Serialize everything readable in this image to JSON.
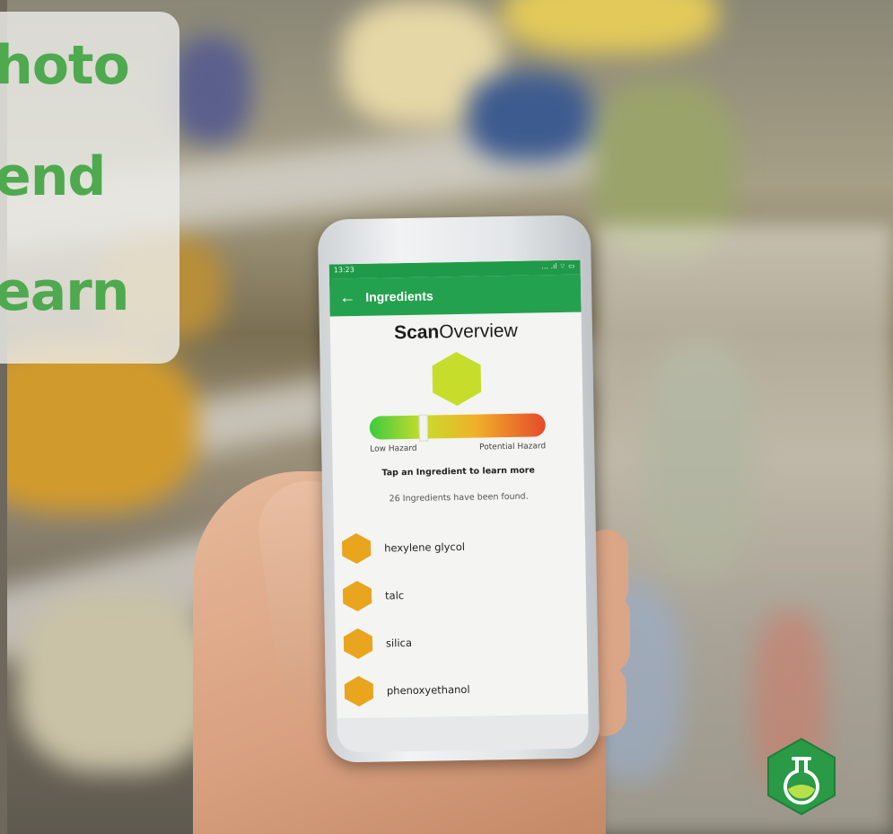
{
  "overlay": {
    "line1": "hoto",
    "line2": "end",
    "line3": "earn"
  },
  "phone": {
    "status_time": "13:23",
    "status_icons": "... .ıl ⌔ ▭",
    "appbar_title": "Ingredients",
    "scan_title_bold": "Scan",
    "scan_title_rest": "Overview",
    "overall_hazard_color": "#c6dd2c",
    "hazard_position": 0.3,
    "meter_low_label": "Low Hazard",
    "meter_high_label": "Potential Hazard",
    "tap_hint": "Tap an Ingredient to learn more",
    "found_text": "26 Ingredients have been found.",
    "ingredients": [
      {
        "name": "hexylene glycol",
        "color": "#e8a51d"
      },
      {
        "name": "talc",
        "color": "#e8a51d"
      },
      {
        "name": "silica",
        "color": "#e8a51d"
      },
      {
        "name": "phenoxyethanol",
        "color": "#e8a51d"
      }
    ]
  },
  "colors": {
    "brand_green": "#24a14f",
    "overlay_text_green": "#4ea94f"
  },
  "logo": {
    "icon": "flask-icon"
  }
}
